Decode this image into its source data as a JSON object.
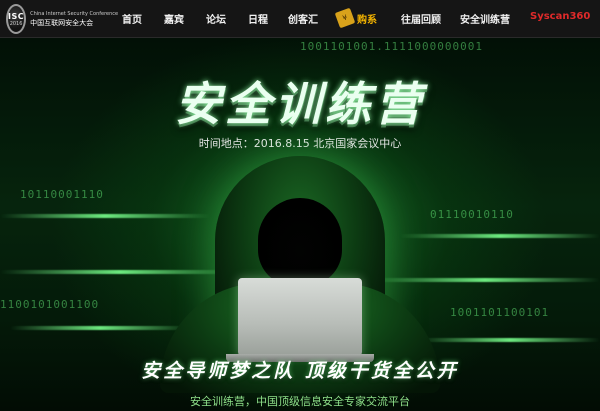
{
  "header": {
    "logo": {
      "badge": "ISC",
      "year": "2016",
      "english_name": "China Internet Security Conference",
      "chinese_name": "中国互联网安全大会"
    },
    "nav": [
      {
        "label": "首页"
      },
      {
        "label": "嘉宾"
      },
      {
        "label": "论坛"
      },
      {
        "label": "日程"
      },
      {
        "label": "创客汇"
      },
      {
        "label": "购系"
      },
      {
        "label": "往届回顾"
      },
      {
        "label": "安全训练营"
      },
      {
        "label": "Syscan360"
      }
    ]
  },
  "hero": {
    "title": "安全训练营",
    "time_location": "时间地点：2016.8.15  北京国家会议中心",
    "slogan": "安全导师梦之队  顶级干货全公开",
    "subtitle": "安全训练营，中国顶级信息安全专家交流平台"
  },
  "colors": {
    "nav_background": "#151515",
    "hero_green": "#1e7a28",
    "subtitle_green": "#8fe08a",
    "brand_red": "#e02a2a"
  }
}
